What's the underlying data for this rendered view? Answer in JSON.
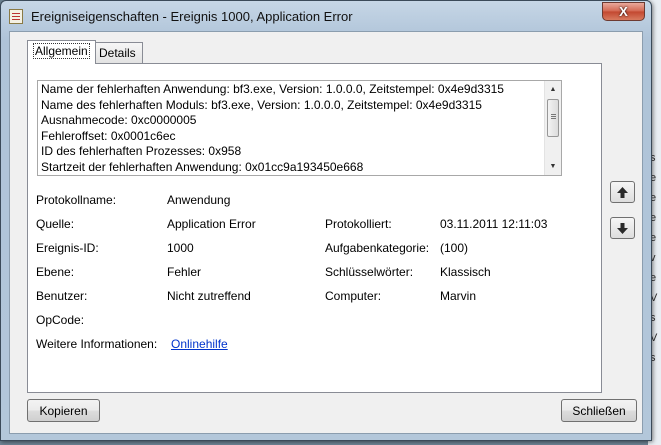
{
  "window": {
    "title": "Ereigniseigenschaften - Ereignis 1000, Application Error",
    "close_label": "X"
  },
  "tabs": [
    {
      "label": "Allgemein",
      "active": true
    },
    {
      "label": "Details",
      "active": false
    }
  ],
  "description_lines": [
    "Name der fehlerhaften Anwendung: bf3.exe, Version: 1.0.0.0, Zeitstempel: 0x4e9d3315",
    "Name des fehlerhaften Moduls: bf3.exe, Version: 1.0.0.0, Zeitstempel: 0x4e9d3315",
    "Ausnahmecode: 0xc0000005",
    "Fehleroffset: 0x0001c6ec",
    "ID des fehlerhaften Prozesses: 0x958",
    "Startzeit der fehlerhaften Anwendung: 0x01cc9a193450e668"
  ],
  "properties": {
    "protokollname": {
      "label": "Protokollname:",
      "value": "Anwendung"
    },
    "quelle": {
      "label": "Quelle:",
      "value": "Application Error"
    },
    "protokolliert": {
      "label": "Protokolliert:",
      "value": "03.11.2011 12:11:03"
    },
    "ereignis_id": {
      "label": "Ereignis-ID:",
      "value": "1000"
    },
    "aufgabenkategorie": {
      "label": "Aufgabenkategorie:",
      "value": "(100)"
    },
    "ebene": {
      "label": "Ebene:",
      "value": "Fehler"
    },
    "schluesselwoerter": {
      "label": "Schlüsselwörter:",
      "value": "Klassisch"
    },
    "benutzer": {
      "label": "Benutzer:",
      "value": "Nicht zutreffend"
    },
    "computer": {
      "label": "Computer:",
      "value": "Marvin"
    },
    "opcode": {
      "label": "OpCode:",
      "value": ""
    },
    "weitere_informationen": {
      "label": "Weitere Informationen:",
      "link": "Onlinehilfe"
    }
  },
  "buttons": {
    "copy_label": "Kopieren",
    "close_label": "Schließen"
  },
  "icons": {
    "app": "event-viewer-icon",
    "up": "arrow-up-icon",
    "down": "arrow-down-icon"
  },
  "background_window": {
    "letters": [
      "s",
      "e",
      "e",
      "e",
      "e",
      "v",
      "e",
      "V",
      "s",
      "V",
      "s"
    ]
  },
  "colors": {
    "link": "#0033cc",
    "close_button": "#c2472f",
    "frame": "#aec3d8"
  }
}
